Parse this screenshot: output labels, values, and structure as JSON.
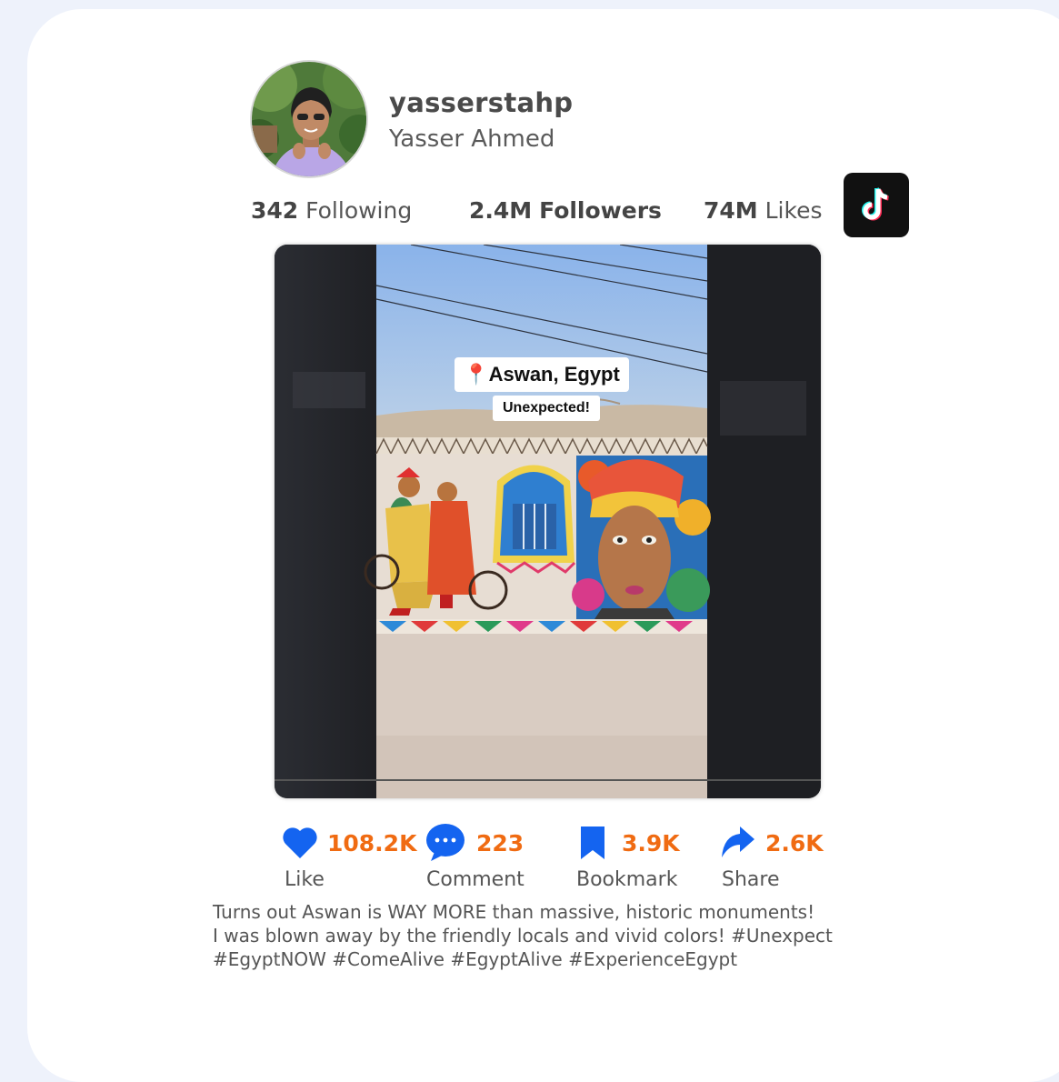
{
  "profile": {
    "username": "yasserstahp",
    "full_name": "Yasser Ahmed"
  },
  "stats": {
    "following_count": "342",
    "following_label": "Following",
    "followers_count": "2.4M",
    "followers_label": "Followers",
    "likes_count": "74M",
    "likes_label": "Likes"
  },
  "video": {
    "location_pin": "📍",
    "location_text": "Aswan, Egypt",
    "subtitle_text": "Unexpected!"
  },
  "actions": [
    {
      "icon": "heart-icon",
      "count": "108.2K",
      "label": "Like"
    },
    {
      "icon": "comment-icon",
      "count": "223",
      "label": "Comment"
    },
    {
      "icon": "bookmark-icon",
      "count": "3.9K",
      "label": "Bookmark"
    },
    {
      "icon": "share-icon",
      "count": "2.6K",
      "label": "Share"
    }
  ],
  "caption": {
    "line1": "Turns out Aswan is WAY MORE than massive, historic monuments!",
    "line2": "I was blown away by the friendly locals and vivid colors! #Unexpect",
    "line3": "#EgyptNOW #ComeAlive #EgyptAlive #ExperienceEgypt"
  },
  "colors": {
    "icon_blue": "#1464f0",
    "count_orange": "#f06b12",
    "page_background": "#eef2fb",
    "card_background": "#ffffff"
  }
}
